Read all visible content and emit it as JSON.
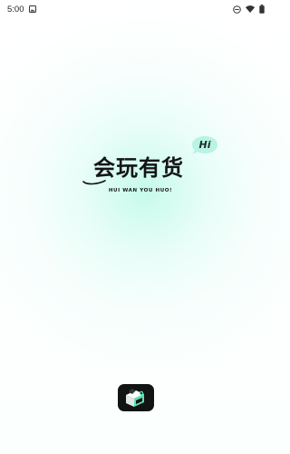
{
  "status_bar": {
    "time": "5:00",
    "icons": [
      "image-icon",
      "do-not-disturb-icon",
      "wifi-icon",
      "battery-icon"
    ]
  },
  "splash": {
    "badge": "Hi",
    "title": "会玩有货",
    "subtitle": "HUI WAN YOU HUO!",
    "accent_color": "#b9f3e3"
  },
  "app_icon": {
    "icon": "app-logo-icon",
    "colors": [
      "#111412",
      "#5ee0b9"
    ]
  }
}
